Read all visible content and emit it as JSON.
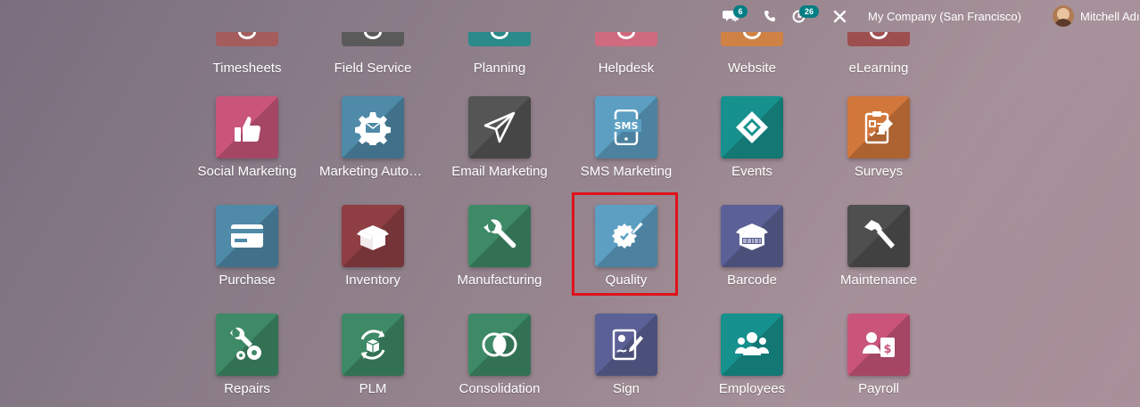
{
  "topbar": {
    "messages_count": "6",
    "activity_count": "26",
    "company": "My Company (San Francisco)",
    "user": "Mitchell Adı"
  },
  "icons": {
    "messages": "chat-bubbles-icon",
    "phone": "phone-icon",
    "activity": "clock-icon",
    "debug": "tools-icon"
  },
  "apps": {
    "row1": [
      "Timesheets",
      "Field Service",
      "Planning",
      "Helpdesk",
      "Website",
      "eLearning"
    ],
    "row2": [
      "Social Marketing",
      "Marketing Automat...",
      "Email Marketing",
      "SMS Marketing",
      "Events",
      "Surveys"
    ],
    "row3": [
      "Purchase",
      "Inventory",
      "Manufacturing",
      "Quality",
      "Barcode",
      "Maintenance"
    ],
    "row4": [
      "Repairs",
      "PLM",
      "Consolidation",
      "Sign",
      "Employees",
      "Payroll"
    ]
  },
  "highlighted_app": "Quality",
  "colors": {
    "highlight_border": "#e0121a",
    "badge": "#017e84"
  }
}
